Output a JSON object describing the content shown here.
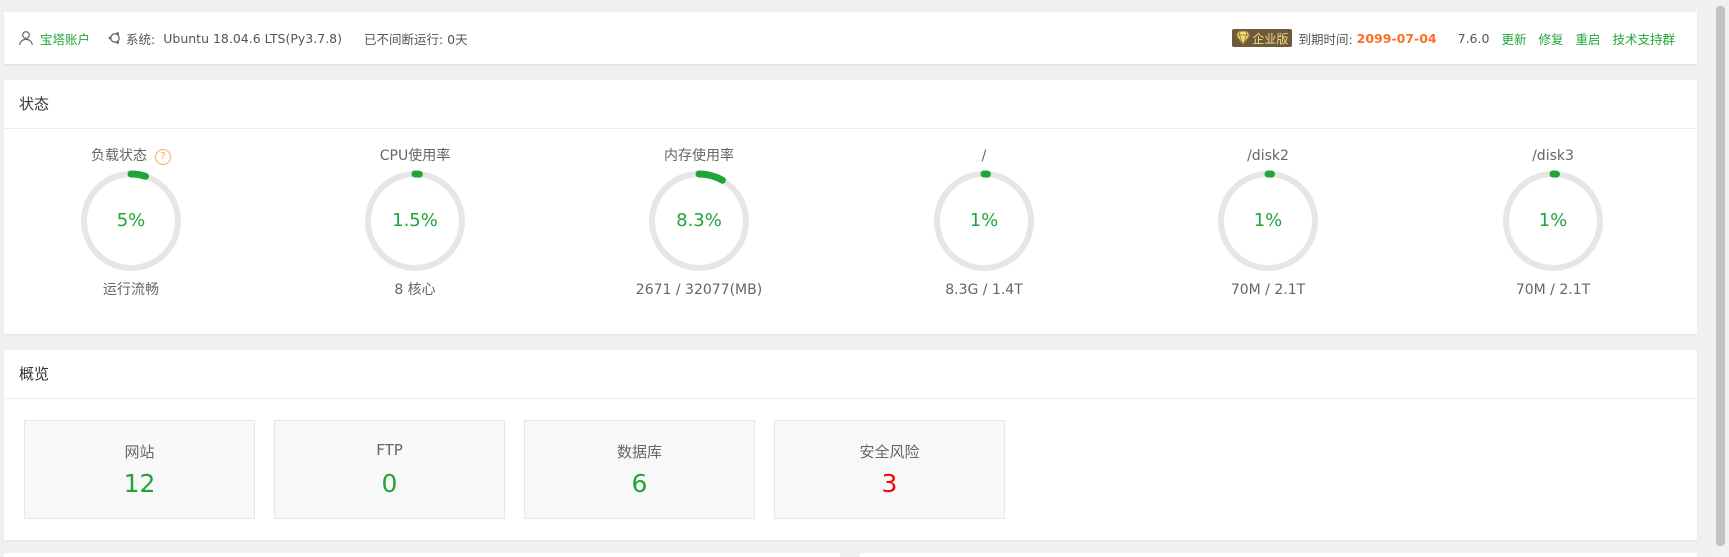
{
  "header": {
    "account_label": "宝塔账户",
    "system_prefix": "系统:",
    "system_value": "Ubuntu 18.04.6 LTS(Py3.7.8)",
    "uptime": "已不间断运行: 0天",
    "edition_badge": "企业版",
    "expire_label": "到期时间:",
    "expire_date": "2099-07-04",
    "version": "7.6.0",
    "links": [
      "更新",
      "修复",
      "重启",
      "技术支持群"
    ]
  },
  "status": {
    "title": "状态",
    "gauges": [
      {
        "title": "负载状态",
        "value": "5%",
        "percent": 5,
        "sub": "运行流畅",
        "help": "?"
      },
      {
        "title": "CPU使用率",
        "value": "1.5%",
        "percent": 1.5,
        "sub": "8 核心"
      },
      {
        "title": "内存使用率",
        "value": "8.3%",
        "percent": 8.3,
        "sub": "2671 / 32077(MB)"
      },
      {
        "title": "/",
        "value": "1%",
        "percent": 1,
        "sub": "8.3G / 1.4T"
      },
      {
        "title": "/disk2",
        "value": "1%",
        "percent": 1,
        "sub": "70M / 2.1T"
      },
      {
        "title": "/disk3",
        "value": "1%",
        "percent": 1,
        "sub": "70M / 2.1T"
      }
    ]
  },
  "overview": {
    "title": "概览",
    "cards": [
      {
        "title": "网站",
        "value": "12"
      },
      {
        "title": "FTP",
        "value": "0"
      },
      {
        "title": "数据库",
        "value": "6"
      },
      {
        "title": "安全风险",
        "value": "3"
      }
    ]
  },
  "colors": {
    "accent": "#20a53a",
    "danger": "#ef0808",
    "expire": "#fc6d26",
    "ring_track": "#e6e6e6"
  }
}
